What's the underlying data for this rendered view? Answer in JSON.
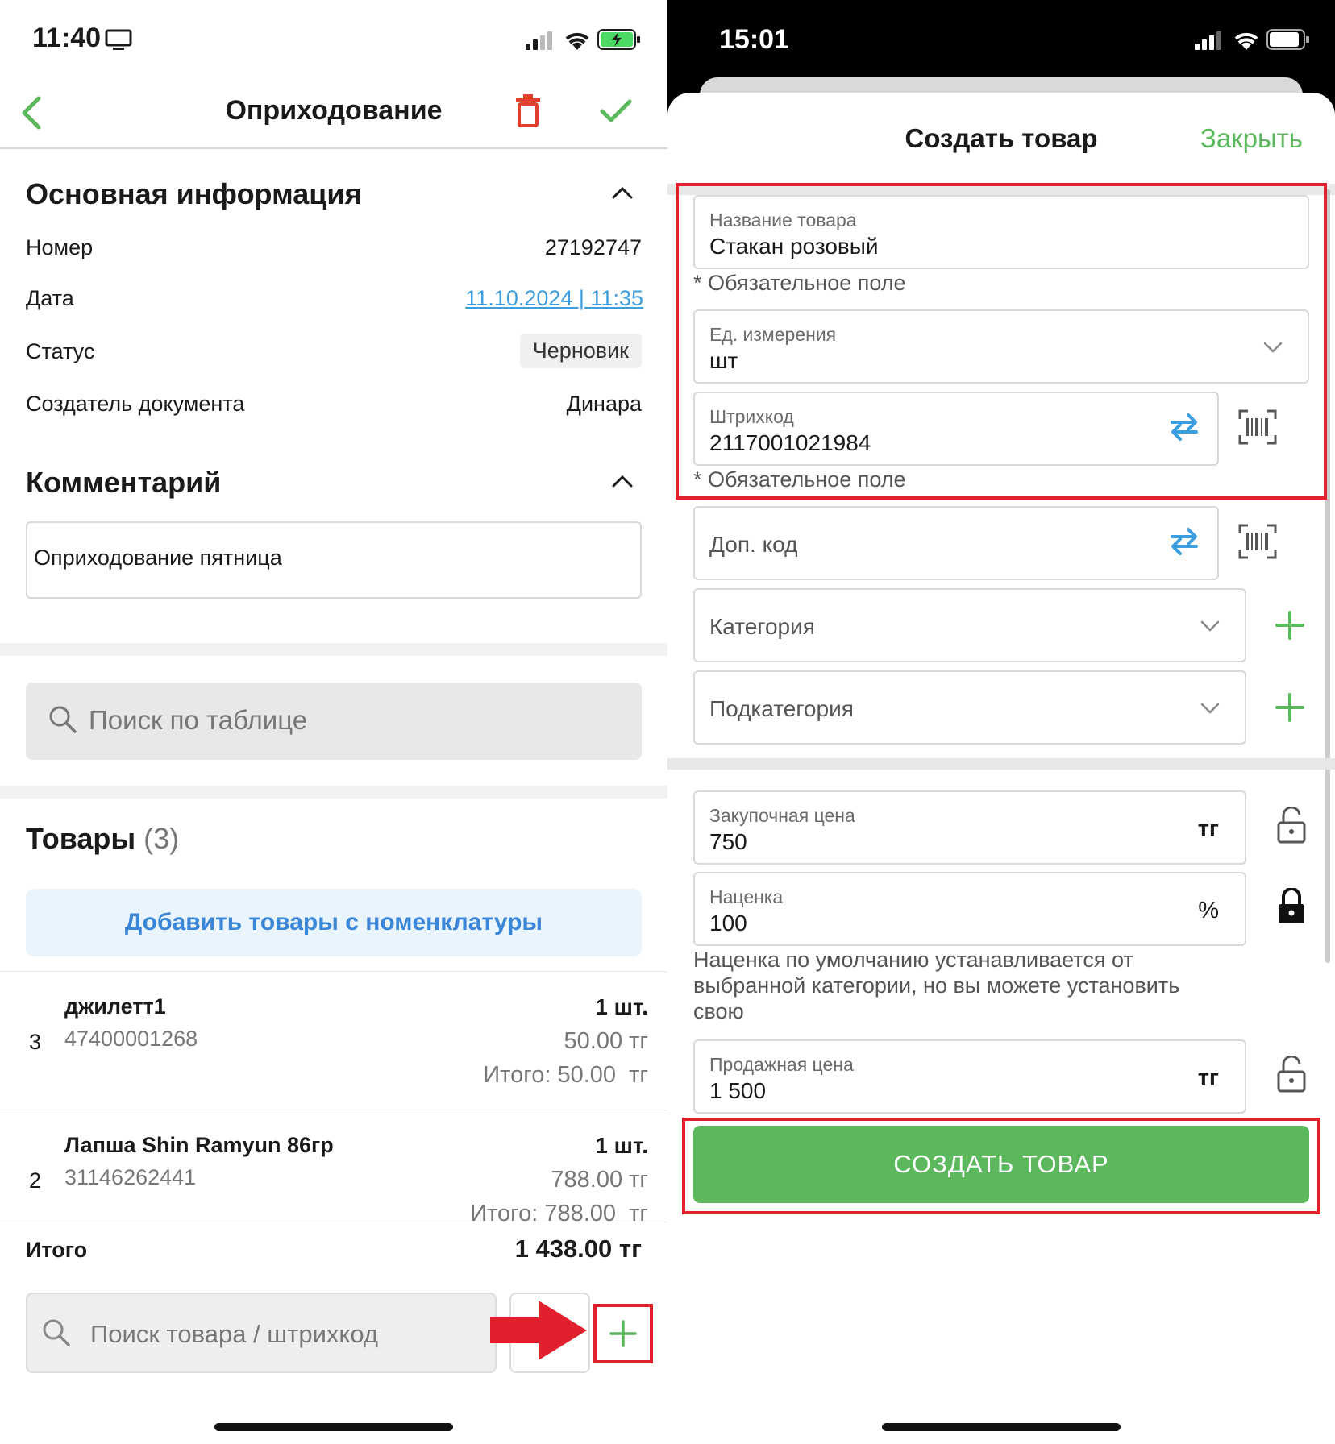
{
  "left": {
    "status_time": "11:40",
    "title": "Оприходование",
    "main_info": {
      "title": "Основная информация",
      "rows": [
        {
          "label": "Номер",
          "value": "27192747"
        },
        {
          "label": "Дата",
          "value": "11.10.2024 | 11:35"
        },
        {
          "label": "Статус",
          "value": "Черновик"
        },
        {
          "label": "Создатель документа",
          "value": "Динара"
        }
      ]
    },
    "comment": {
      "title": "Комментарий",
      "text": "Оприходование пятница"
    },
    "table_search_placeholder": "Поиск по таблице",
    "products": {
      "title": "Товары",
      "count": "(3)",
      "add_button": "Добавить товары с номенклатуры",
      "items": [
        {
          "index": "3",
          "name": "джилетт1",
          "code": "47400001268",
          "qty": "1 шт.",
          "price": "50.00 тг",
          "total": "Итого: 50.00  тг"
        },
        {
          "index": "2",
          "name": "Лапша Shin Ramyun 86гр",
          "code": "31146262441",
          "qty": "1 шт.",
          "price": "788.00 тг",
          "total": "Итого: 788.00  тг"
        }
      ]
    },
    "footer": {
      "total_label": "Итого",
      "total_value": "1 438.00 тг",
      "search_placeholder": "Поиск товара / штрихкод"
    },
    "colors": {
      "accent_green": "#5cb85c",
      "link_blue": "#3a9ee0",
      "delete_red": "#e0402d",
      "annotation_red": "#e0202d"
    }
  },
  "right": {
    "status_time": "15:01",
    "sheet_title": "Создать товар",
    "close_label": "Закрыть",
    "fields": {
      "name": {
        "label": "Название товара",
        "value": "Стакан розовый"
      },
      "unit": {
        "label": "Ед. измерения",
        "value": "шт"
      },
      "barcode": {
        "label": "Штрихкод",
        "value": "2117001021984"
      },
      "extra_code": {
        "placeholder": "Доп. код"
      },
      "category": {
        "placeholder": "Категория"
      },
      "subcategory": {
        "placeholder": "Подкатегория"
      },
      "purchase_price": {
        "label": "Закупочная цена",
        "value": "750",
        "unit": "тг"
      },
      "markup": {
        "label": "Наценка",
        "value": "100",
        "unit": "%"
      },
      "sale_price": {
        "label": "Продажная цена",
        "value": "1 500",
        "unit": "тг"
      }
    },
    "required_note": "* Обязательное поле",
    "markup_hint": "Наценка по умолчанию устанавливается от выбранной категории, но вы можете установить свою",
    "create_button": "СОЗДАТЬ ТОВАР",
    "colors": {
      "accent_green": "#5cb85c",
      "swap_blue": "#3a9ee0"
    }
  }
}
